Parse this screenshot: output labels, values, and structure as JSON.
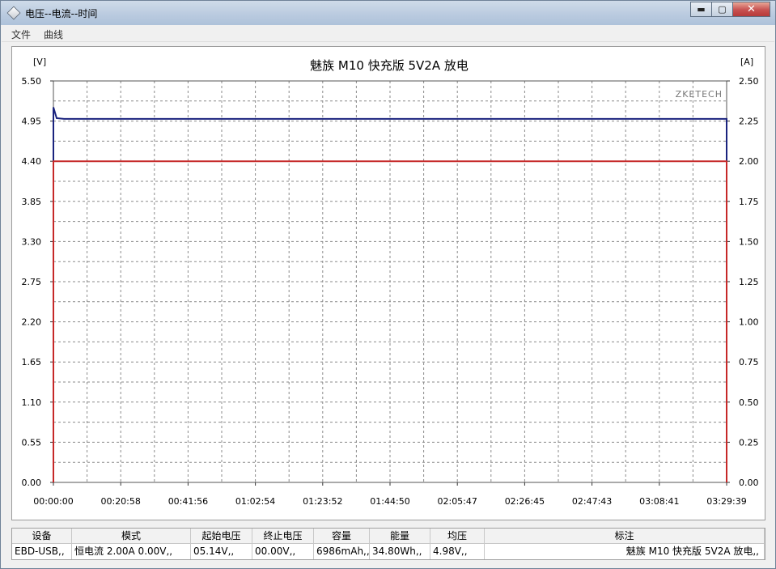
{
  "window": {
    "title": "电压--电流--时间",
    "buttons": {
      "minimize": "▬",
      "maximize": "▢",
      "close": "✕"
    }
  },
  "menu": [
    {
      "label": "文件"
    },
    {
      "label": "曲线"
    }
  ],
  "chart_data": {
    "type": "line",
    "title": "魅族 M10 快充版 5V2A 放电",
    "watermark": "ZKETECH",
    "left_axis": {
      "unit": "[V]",
      "ylim": [
        0,
        5.5
      ],
      "ticks": [
        "5.50",
        "4.95",
        "4.40",
        "3.85",
        "3.30",
        "2.75",
        "2.20",
        "1.65",
        "1.10",
        "0.55",
        "0.00"
      ]
    },
    "right_axis": {
      "unit": "[A]",
      "ylim": [
        0,
        2.5
      ],
      "ticks": [
        "2.50",
        "2.25",
        "2.00",
        "1.75",
        "1.50",
        "1.25",
        "1.00",
        "0.75",
        "0.50",
        "0.25",
        "0.00"
      ]
    },
    "x_ticks": [
      "00:00:00",
      "00:20:58",
      "00:41:56",
      "01:02:54",
      "01:23:52",
      "01:44:50",
      "02:05:47",
      "02:26:45",
      "02:47:43",
      "03:08:41",
      "03:29:39"
    ],
    "xlim": [
      0,
      12579
    ],
    "grid": true,
    "series": [
      {
        "axis": "left",
        "color": "#1a237e",
        "points": [
          [
            0,
            0.0
          ],
          [
            0,
            5.14
          ],
          [
            60,
            4.99
          ],
          [
            200,
            4.98
          ],
          [
            6000,
            4.98
          ],
          [
            12579,
            4.98
          ],
          [
            12579,
            0.0
          ]
        ]
      },
      {
        "axis": "right",
        "color": "#c62828",
        "points": [
          [
            0,
            0.0
          ],
          [
            0,
            2.0
          ],
          [
            12579,
            2.0
          ],
          [
            12579,
            0.0
          ]
        ]
      }
    ]
  },
  "table": {
    "headers": [
      "设备",
      "模式",
      "起始电压",
      "终止电压",
      "容量",
      "能量",
      "均压",
      "标注"
    ],
    "row": [
      "EBD-USB,,",
      "恒电流  2.00A  0.00V,,",
      "05.14V,,",
      "00.00V,,",
      "6986mAh,,",
      "34.80Wh,,",
      "4.98V,,",
      "魅族 M10 快充版 5V2A 放电,,"
    ]
  },
  "colors": {
    "voltage_line": "#1a237e",
    "current_line": "#c62828",
    "grid": "#7a7a7a"
  }
}
